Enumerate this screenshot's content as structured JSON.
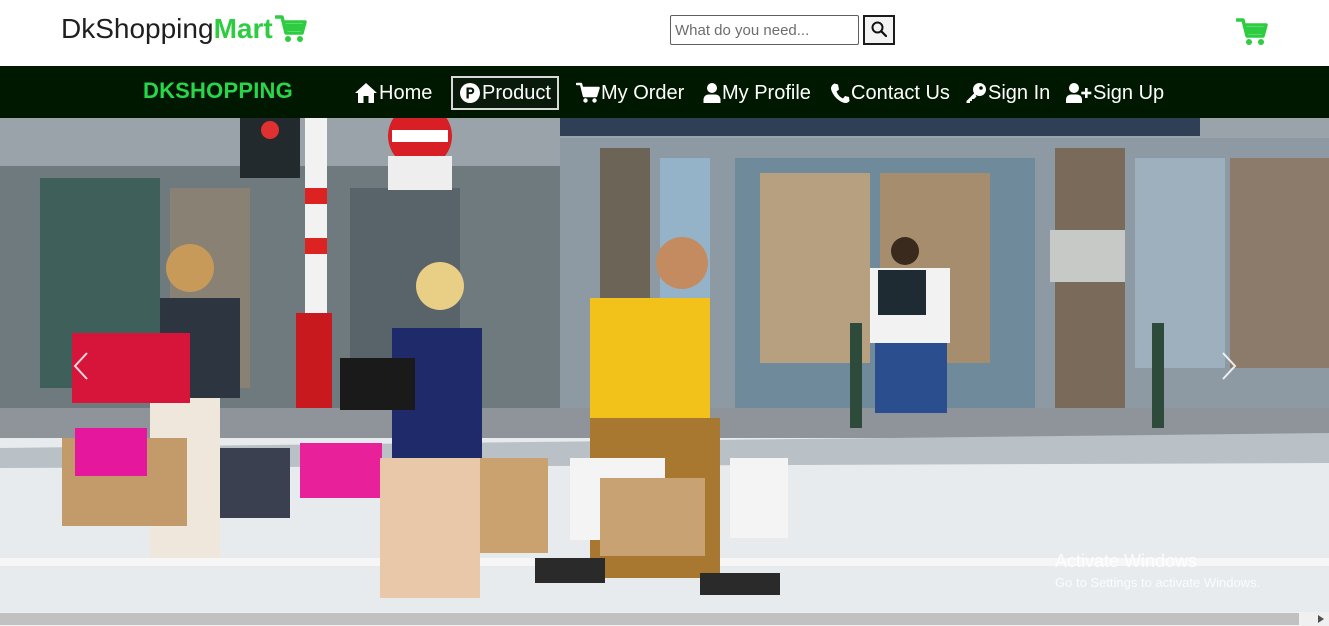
{
  "header": {
    "brand_prefix": "DkShopping",
    "brand_suffix": "Mart",
    "brand_icon": "cart-icon",
    "search_placeholder": "What do you need...",
    "search_value": "",
    "search_icon": "search-icon",
    "cart_icon": "cart-icon"
  },
  "nav": {
    "brand": "DKSHOPPING",
    "items": [
      {
        "label": "Home",
        "icon": "home-icon",
        "active": false
      },
      {
        "label": "Product",
        "icon": "product-p-icon",
        "active": true
      },
      {
        "label": "My Order",
        "icon": "cart-icon",
        "active": false
      },
      {
        "label": "My Profile",
        "icon": "user-icon",
        "active": false
      },
      {
        "label": "Contact Us",
        "icon": "phone-icon",
        "active": false
      },
      {
        "label": "Sign In",
        "icon": "key-icon",
        "active": false
      },
      {
        "label": "Sign Up",
        "icon": "user-plus-icon",
        "active": false
      }
    ]
  },
  "carousel": {
    "prev_icon": "chevron-left-icon",
    "next_icon": "chevron-right-icon"
  },
  "watermark": {
    "title": "Activate Windows",
    "subtitle": "Go to Settings to activate Windows."
  },
  "colors": {
    "accent_green": "#2ecc40",
    "nav_background": "#001800",
    "nav_brand": "#29d64a"
  }
}
